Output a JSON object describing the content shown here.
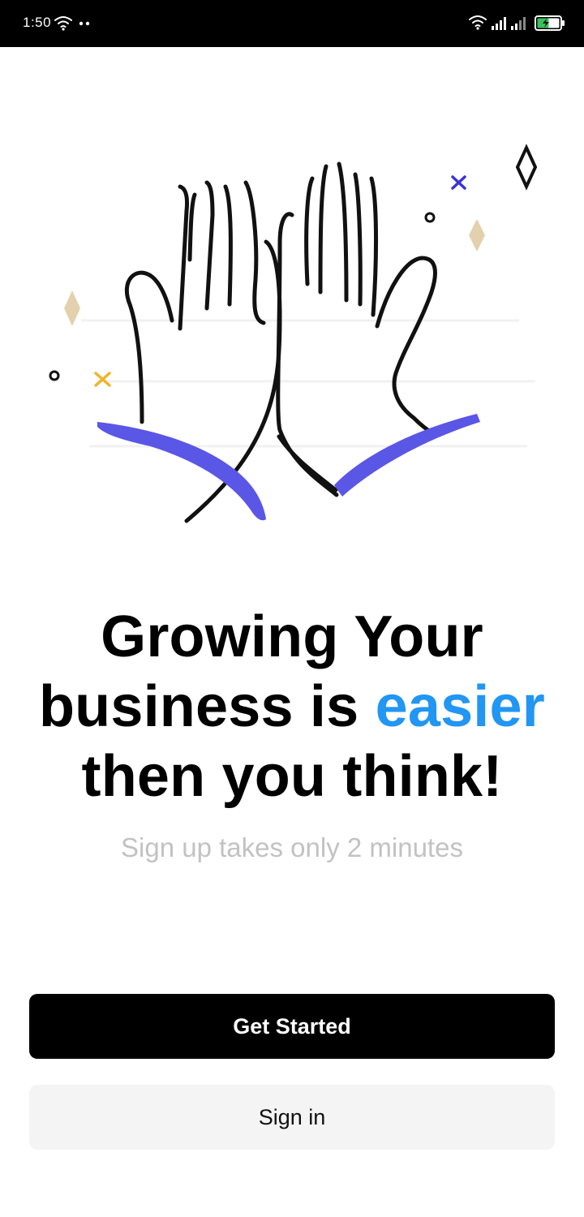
{
  "status_bar": {
    "time": "1:50",
    "icons": [
      "wifi-icon",
      "dots-icon",
      "wifi-icon",
      "signal-icon",
      "signal-icon",
      "battery-charging-icon"
    ]
  },
  "illustration": {
    "name": "high-five-hands-illustration",
    "colors": {
      "outline": "#111111",
      "sleeve": "#5a56e6",
      "diamond": "#e3d1ad",
      "x_blue": "#3b33d8",
      "x_yellow": "#f0b429"
    }
  },
  "hero": {
    "line1": "Growing Your",
    "line2_prefix": "business is ",
    "line2_accent": "easier",
    "line3": "then you think!",
    "accent_color": "#2196f3"
  },
  "subtitle": "Sign up takes only 2 minutes",
  "actions": {
    "primary_label": "Get Started",
    "secondary_label": "Sign in"
  }
}
